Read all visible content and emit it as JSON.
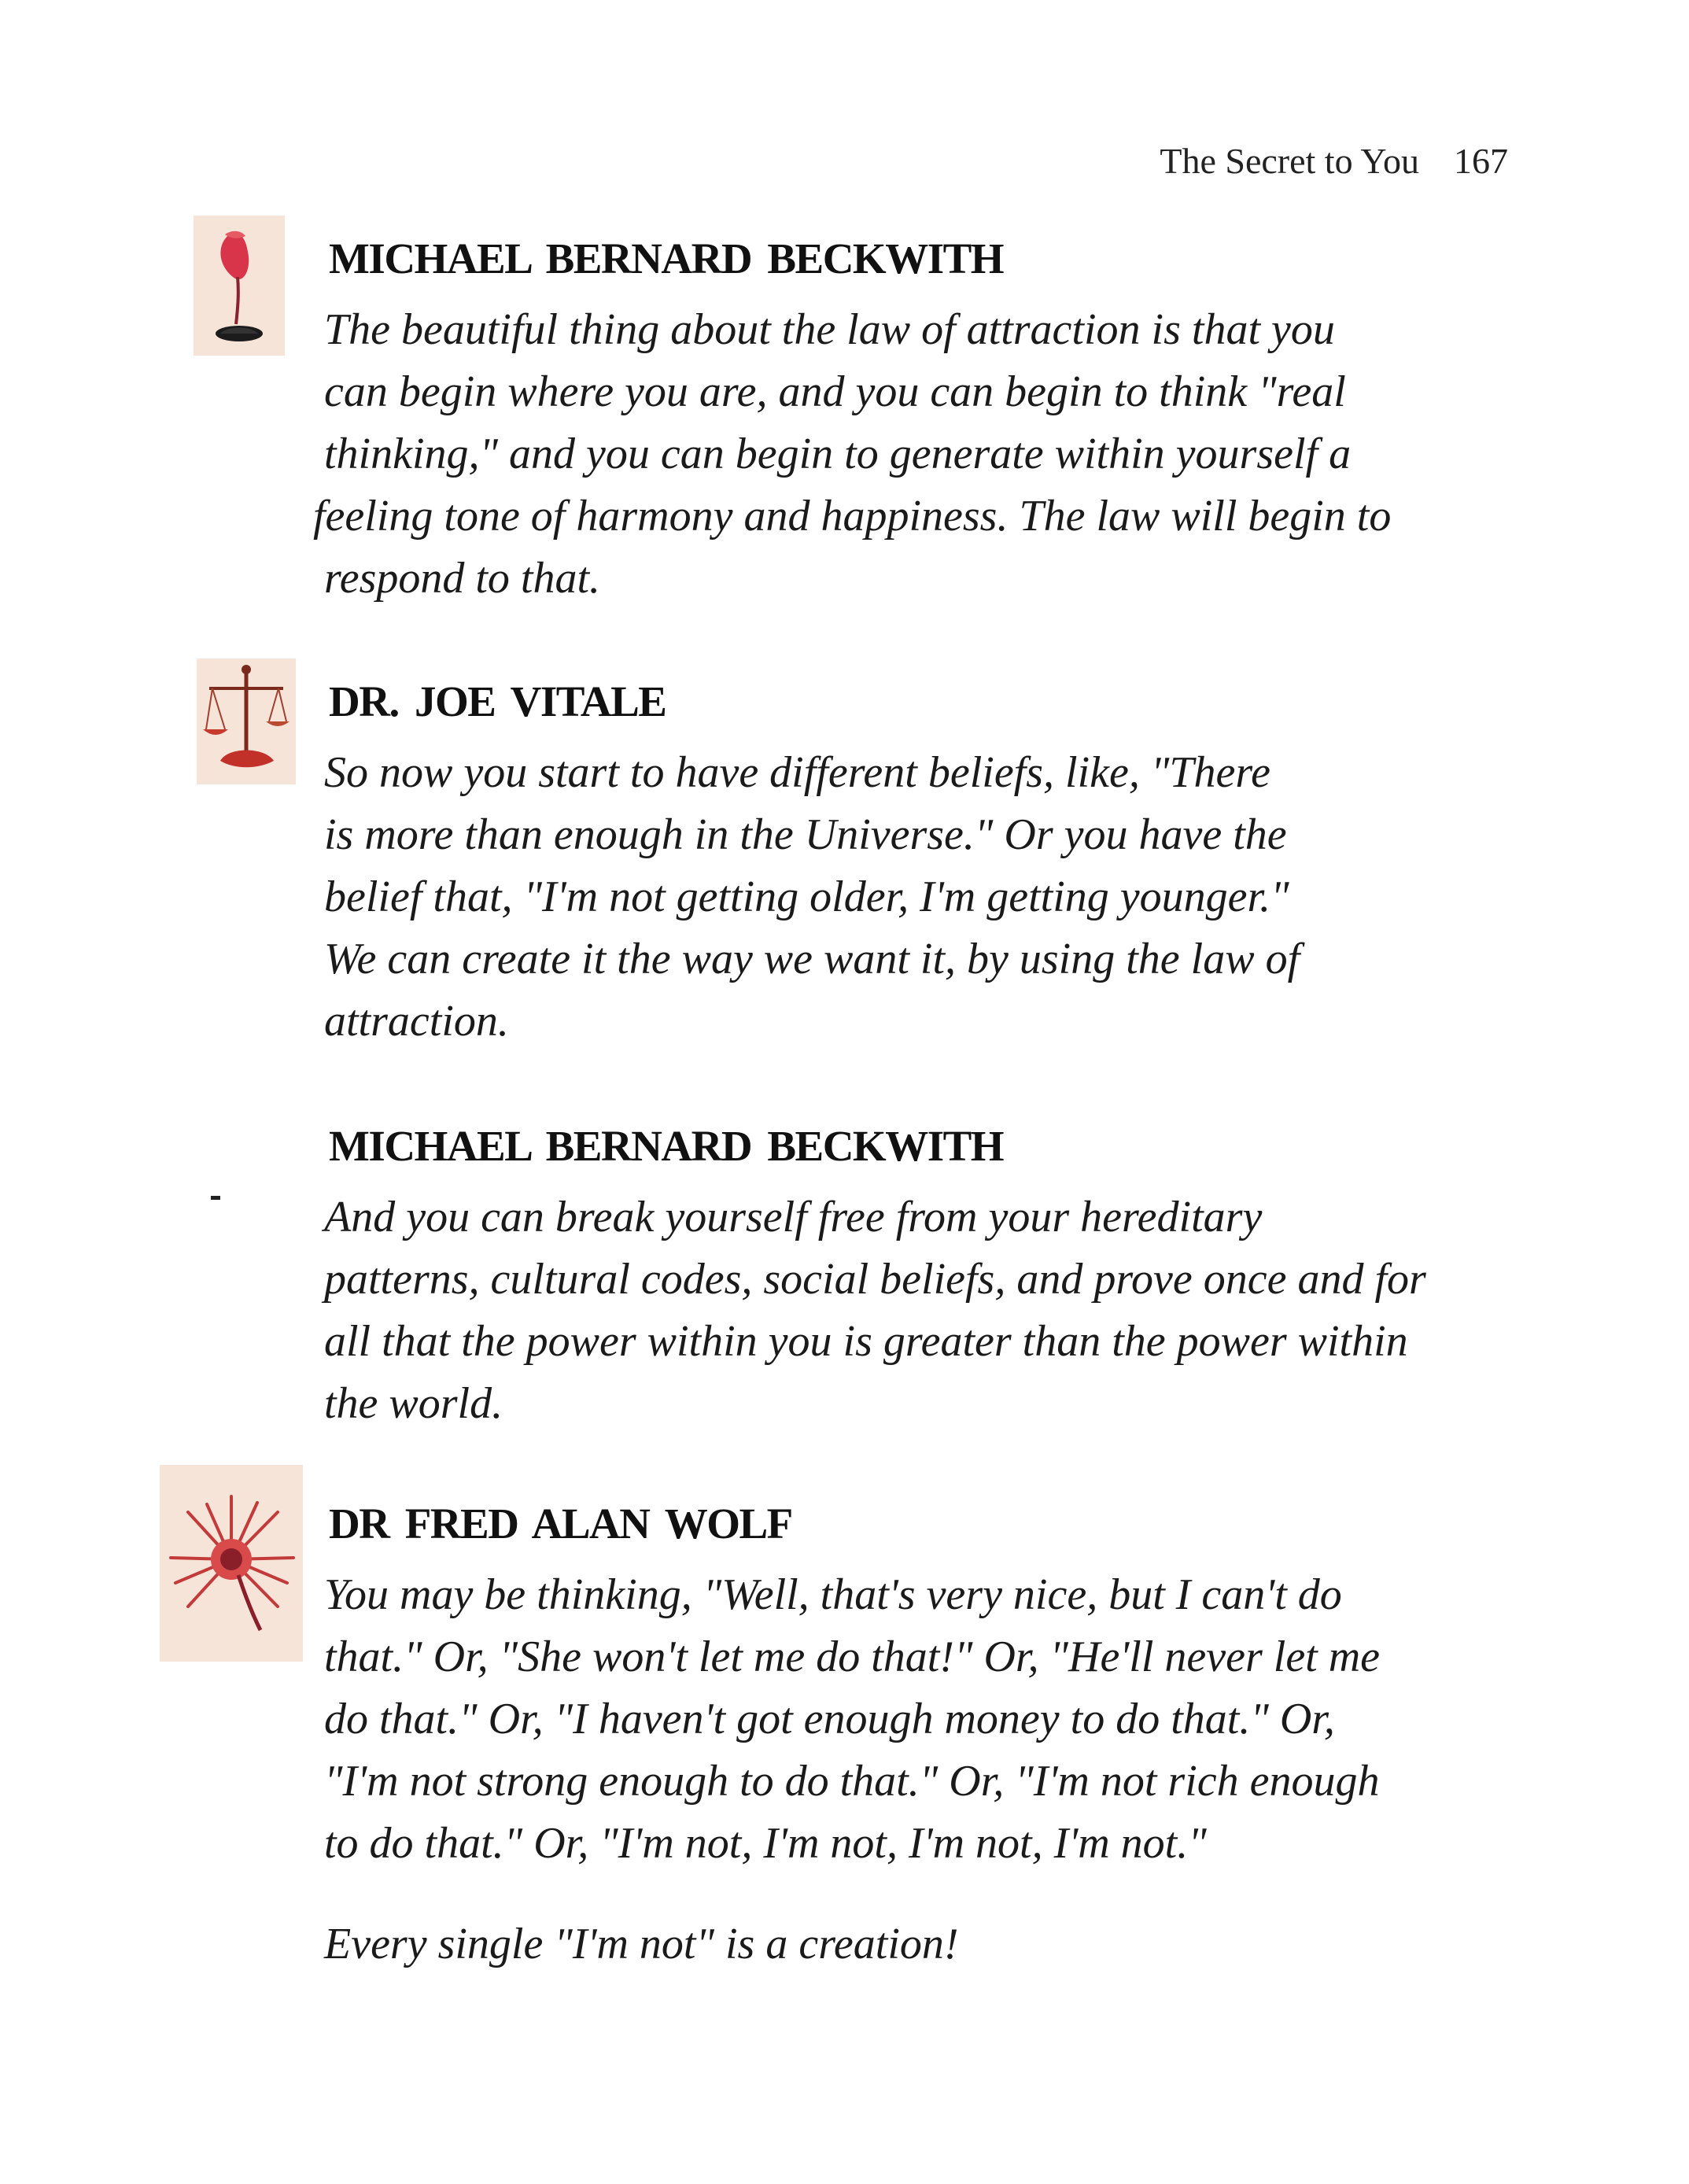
{
  "header": {
    "running_title": "The Secret to You",
    "page_number": "167"
  },
  "sections": [
    {
      "speaker": "MICHAEL BERNARD BECKWITH",
      "icon": "calla-lily-icon",
      "lines": [
        "The beautiful thing about the law of attraction is that you",
        "can begin where you are, and you can begin to think \"real",
        "thinking,\" and you can begin to generate within yourself a",
        "feeling tone of harmony and happiness. The law will begin to",
        "respond to that."
      ]
    },
    {
      "speaker": "DR. JOE VITALE",
      "icon": "scales-icon",
      "lines": [
        "So now you start to have different beliefs, like, \"There",
        "is more than enough in the Universe.\" Or you have the",
        "belief that, \"I'm not getting older, I'm getting younger.\"",
        "We can create it the way we want it, by using the law of",
        "attraction."
      ]
    },
    {
      "speaker": "MICHAEL BERNARD BECKWITH",
      "icon": "",
      "lines": [
        "And you can break yourself free from your hereditary",
        "patterns, cultural codes, social beliefs, and prove once and for",
        "all that the power within you is greater than the power within",
        "the world."
      ]
    },
    {
      "speaker": "DR FRED ALAN WOLF",
      "icon": "starburst-flower-icon",
      "lines": [
        "You may be thinking, \"Well, that's very nice, but I can't do",
        "that.\" Or, \"She won't let me do that!\" Or, \"He'll never let me",
        "do that.\" Or, \"I haven't got enough money to do that.\" Or,",
        "\"I'm not strong enough to do that.\" Or, \"I'm not rich enough",
        "to do that.\" Or, \"I'm not, I'm not, I'm not, I'm not.\""
      ],
      "closing_line": "Every single \"I'm not\" is a creation!"
    }
  ]
}
